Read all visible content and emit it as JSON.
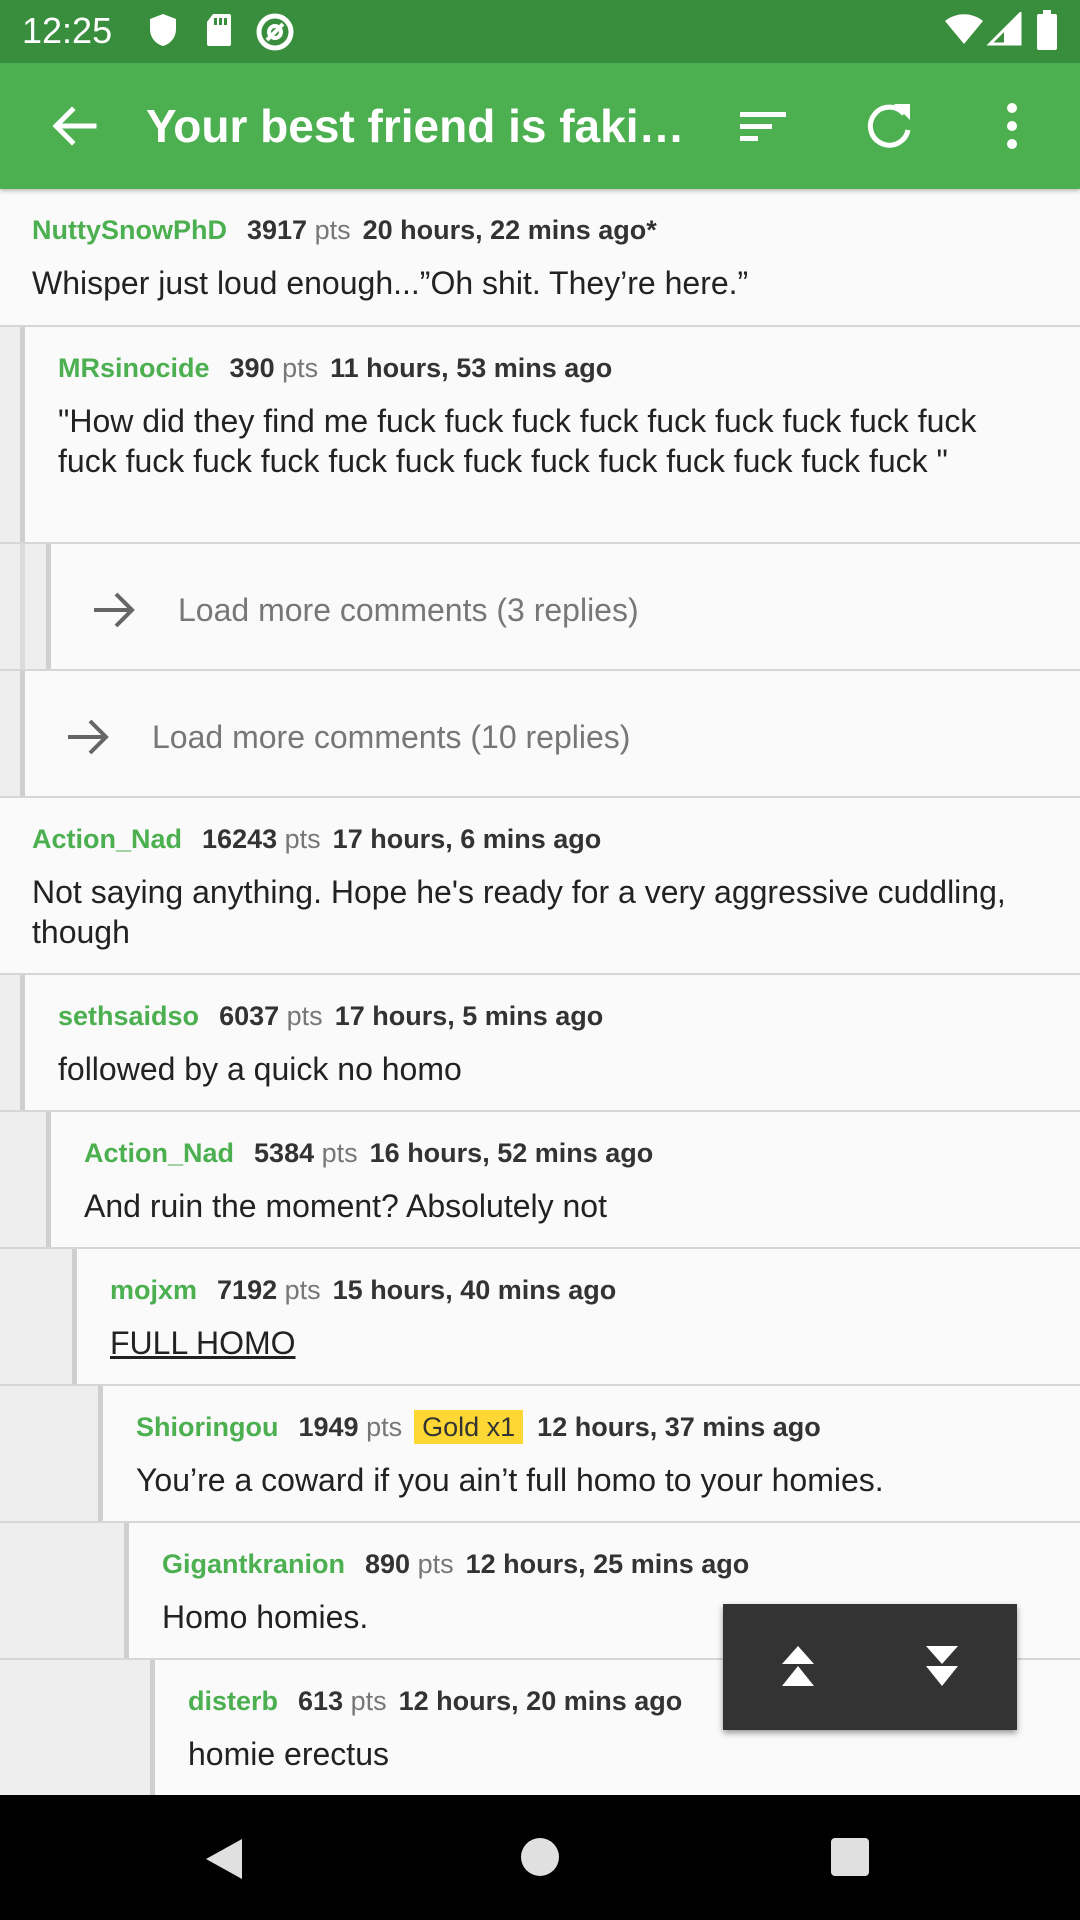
{
  "status_bar": {
    "time": "12:25"
  },
  "app_bar": {
    "title": "Your best friend is faki…"
  },
  "comments": [
    {
      "author": "NuttySnowPhD",
      "points": "3917",
      "pts_label": "pts",
      "time": "20 hours, 22 mins ago*",
      "body": "Whisper just loud enough...”Oh shit. They’re here.”"
    },
    {
      "author": "MRsinocide",
      "points": "390",
      "pts_label": "pts",
      "time": "11 hours, 53 mins ago",
      "body": "\"How did they find me fuck fuck fuck fuck fuck fuck fuck fuck fuck fuck fuck fuck fuck fuck fuck fuck fuck fuck fuck fuck fuck fuck \""
    },
    {
      "author": "Action_Nad",
      "points": "16243",
      "pts_label": "pts",
      "time": "17 hours, 6 mins ago",
      "body": "Not saying anything.  Hope he's ready for a very aggressive cuddling, though"
    },
    {
      "author": "sethsaidso",
      "points": "6037",
      "pts_label": "pts",
      "time": "17 hours, 5 mins ago",
      "body": "followed by a quick no homo"
    },
    {
      "author": "Action_Nad",
      "points": "5384",
      "pts_label": "pts",
      "time": "16 hours, 52 mins ago",
      "body": "And ruin the moment? Absolutely not"
    },
    {
      "author": "mojxm",
      "points": "7192",
      "pts_label": "pts",
      "time": "15 hours, 40 mins ago",
      "body": "FULL HOMO"
    },
    {
      "author": "Shioringou",
      "points": "1949",
      "pts_label": "pts",
      "gold": "Gold x1",
      "time": "12 hours, 37 mins ago",
      "body": "You’re a coward if you ain’t full homo to your homies."
    },
    {
      "author": "Gigantkranion",
      "points": "890",
      "pts_label": "pts",
      "time": "12 hours, 25 mins ago",
      "body": "Homo homies."
    },
    {
      "author": "disterb",
      "points": "613",
      "pts_label": "pts",
      "time": "12 hours, 20 mins ago",
      "body": "homie erectus"
    }
  ],
  "load_more": [
    {
      "label": "Load more comments (3 replies)"
    },
    {
      "label": "Load more comments (10 replies)"
    }
  ],
  "icons": {
    "status": [
      "shield-icon",
      "sd-card-icon",
      "at-sign-icon",
      "wifi-icon",
      "signal-icon",
      "battery-icon"
    ],
    "app_bar": [
      "back-arrow-icon",
      "sort-icon",
      "refresh-icon",
      "more-vert-icon"
    ],
    "fab": [
      "scroll-up-icon",
      "scroll-down-icon"
    ],
    "nav": [
      "nav-back-icon",
      "nav-home-icon",
      "nav-recents-icon"
    ]
  },
  "colors": {
    "status_bar": "#388e3c",
    "app_bar": "#4caf50",
    "author": "#4caf50",
    "gold_badge": "#fdd835"
  }
}
